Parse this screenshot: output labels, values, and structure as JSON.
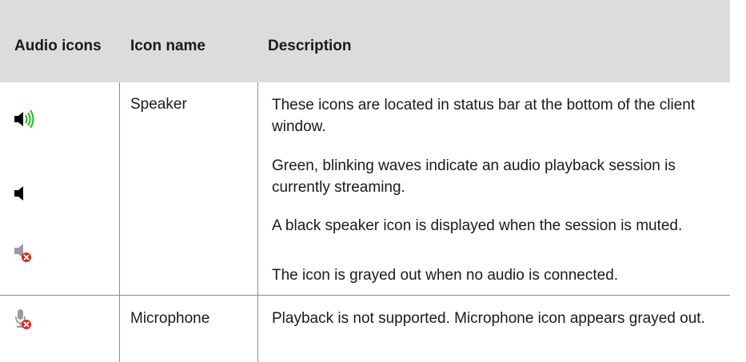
{
  "table": {
    "headers": {
      "audio_icons": "Audio icons",
      "icon_name": "Icon name",
      "description": "Description"
    },
    "rows": [
      {
        "name": "Speaker",
        "icons": [
          "speaker-waves-green-icon",
          "speaker-black-icon",
          "speaker-muted-gray-icon"
        ],
        "descriptions": [
          "These icons are located in status bar at the bottom of the client window.",
          "Green, blinking waves indicate an audio playback session is currently streaming.",
          "A black speaker icon is displayed when the session is muted.",
          "The icon is grayed out when no audio is connected."
        ]
      },
      {
        "name": "Microphone",
        "icons": [
          "microphone-muted-gray-icon"
        ],
        "descriptions": [
          "Playback is not supported. Microphone icon appears grayed out."
        ]
      }
    ]
  },
  "colors": {
    "header_bg": "#dcdcdc",
    "border": "#8c8c8c",
    "wave_green": "#1fbf1f",
    "mute_red": "#d42b1e"
  }
}
